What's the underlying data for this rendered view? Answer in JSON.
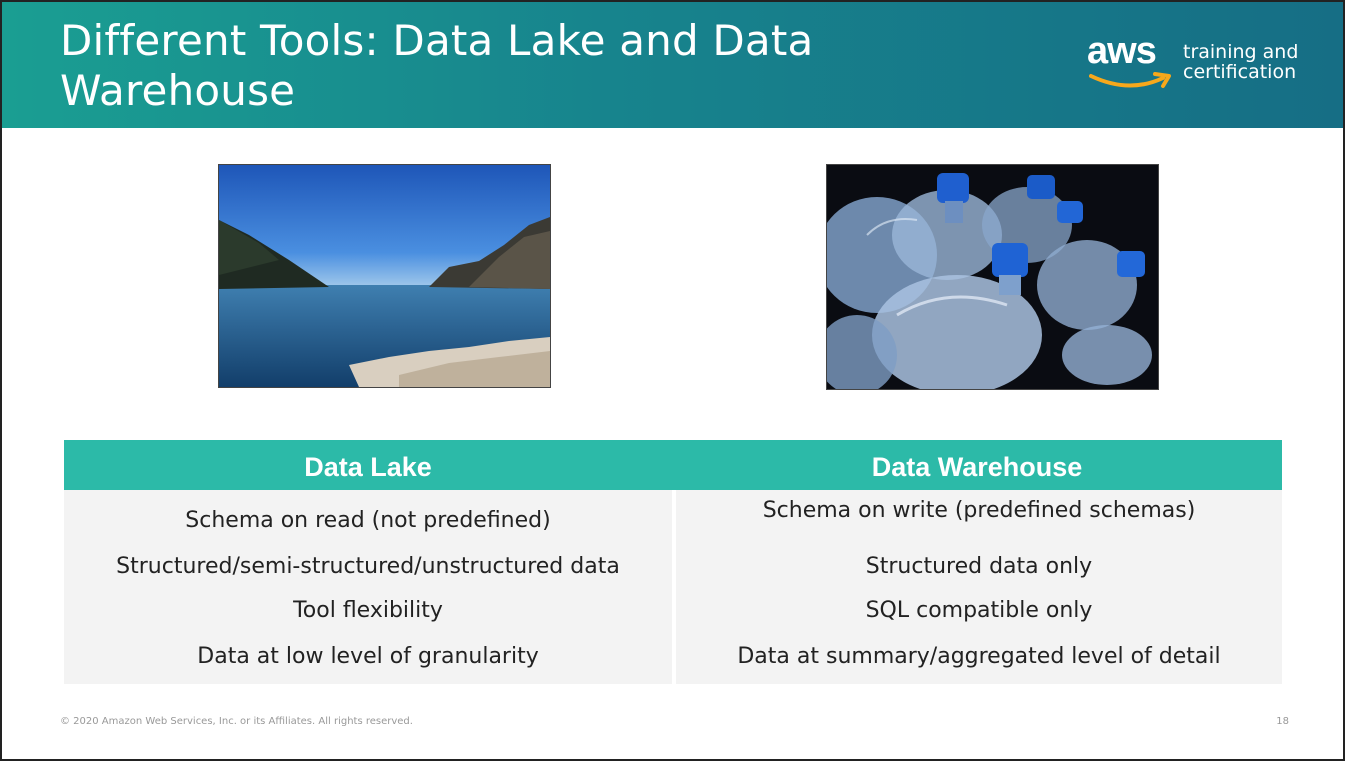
{
  "header": {
    "title_line1": "Different Tools: Data Lake and Data",
    "title_line2": "Warehouse",
    "logo_word": "aws",
    "logo_tag_line1": "training and",
    "logo_tag_line2": "certification"
  },
  "colors": {
    "header_start": "#1a9e92",
    "header_end": "#166e85",
    "table_header": "#2cbaa8",
    "aws_smile": "#f7a81b"
  },
  "images": {
    "left": "lake-photo",
    "right": "water-jugs-photo"
  },
  "table": {
    "left_header": "Data Lake",
    "right_header": "Data Warehouse",
    "left_rows": [
      "Schema on read (not predefined)",
      "Structured/semi-structured/unstructured data",
      "Tool flexibility",
      "Data at low level of granularity"
    ],
    "right_rows": [
      "Schema on write (predefined schemas)",
      "Structured data only",
      "SQL compatible only",
      "Data at summary/aggregated level of detail"
    ]
  },
  "footer": {
    "copyright": "© 2020 Amazon Web Services, Inc. or its Affiliates. All rights reserved.",
    "page": "18"
  }
}
